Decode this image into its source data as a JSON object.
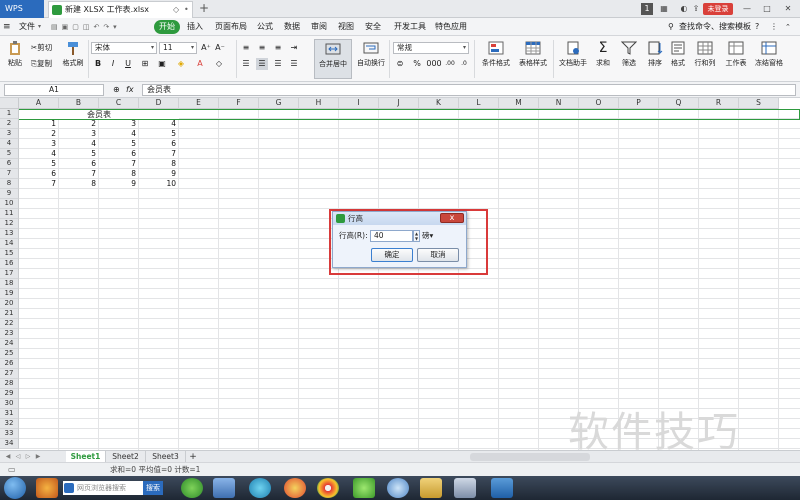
{
  "titlebar": {
    "app_name": "WPS",
    "doc_tab_title": "新建 XLSX 工作表.xlsx",
    "login_label": "未登录",
    "page_indicator": "1"
  },
  "menu": {
    "file_label": "文件",
    "items": [
      "开始",
      "插入",
      "页面布局",
      "公式",
      "数据",
      "审阅",
      "视图",
      "安全",
      "开发工具",
      "特色应用"
    ],
    "search_label": "查找命令、搜索模板"
  },
  "ribbon": {
    "paste": "粘贴",
    "cut": "剪切",
    "copy": "复制",
    "format_painter": "格式刷",
    "font_name": "宋体",
    "font_size": "11",
    "merge_center": "合并居中",
    "wrap_text": "自动换行",
    "number_format": "常规",
    "conditional_format": "条件格式",
    "table_style": "表格样式",
    "doc_helper": "文档助手",
    "sum": "求和",
    "filter": "筛选",
    "sort": "排序",
    "format": "格式",
    "row_col": "行和列",
    "worksheet": "工作表",
    "freeze": "冻结窗格"
  },
  "formula_bar": {
    "cell_ref": "A1",
    "fx": "fx",
    "content": "会员表"
  },
  "grid": {
    "columns": [
      "A",
      "B",
      "C",
      "D",
      "E",
      "F",
      "G",
      "H",
      "I",
      "J",
      "K",
      "L",
      "M",
      "N",
      "O",
      "P",
      "Q",
      "R",
      "S"
    ],
    "row_count": 34,
    "title_text": "会员表",
    "rows": [
      [
        "1",
        "2",
        "3",
        "4"
      ],
      [
        "2",
        "3",
        "4",
        "5"
      ],
      [
        "3",
        "4",
        "5",
        "6"
      ],
      [
        "4",
        "5",
        "6",
        "7"
      ],
      [
        "5",
        "6",
        "7",
        "8"
      ],
      [
        "6",
        "7",
        "8",
        "9"
      ],
      [
        "7",
        "8",
        "9",
        "10"
      ]
    ]
  },
  "dialog": {
    "title": "行高",
    "label": "行高(R):",
    "value": "40",
    "unit": "磅",
    "ok": "确定",
    "cancel": "取消",
    "close": "x"
  },
  "sheets": [
    "Sheet1",
    "Sheet2",
    "Sheet3"
  ],
  "add_sheet": "+",
  "status": {
    "text": "求和=0  平均值=0  计数=1"
  },
  "taskbar": {
    "search_placeholder": "网页浏览器搜索",
    "search_button": "搜索"
  },
  "watermark": "软件技巧",
  "colors": {
    "accent_green": "#2e9a3e",
    "highlight_red": "#d93a3a",
    "login_red": "#d9403a"
  }
}
